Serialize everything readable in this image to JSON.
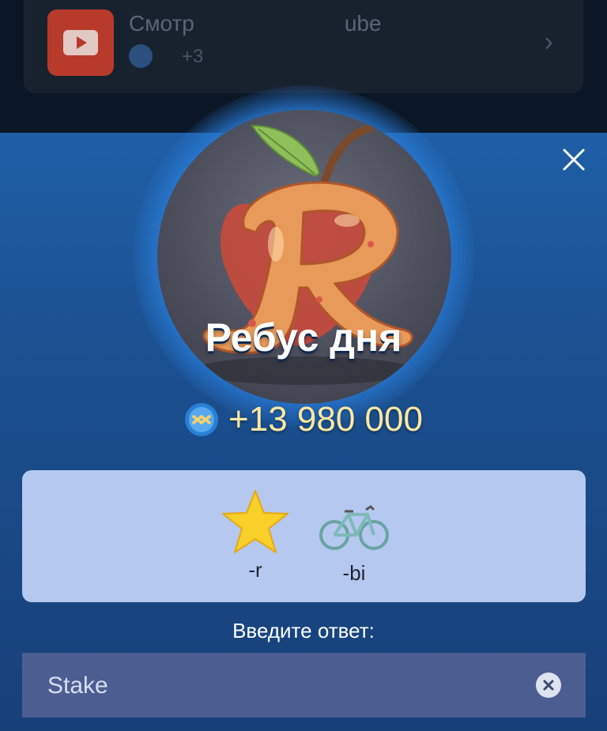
{
  "background_task": {
    "title": "Смотр",
    "title_tail": "ube",
    "reward_prefix": "+3"
  },
  "modal": {
    "title": "Ребус дня",
    "reward": "+13 980 000",
    "puzzle": {
      "items": [
        {
          "icon": "star-icon",
          "hint": "-r"
        },
        {
          "icon": "bicycle-icon",
          "hint": "-bi"
        }
      ]
    },
    "prompt": "Введите ответ:",
    "answer": {
      "value": "Stake"
    }
  },
  "colors": {
    "sheet_top": "#1f5fa6",
    "sheet_bottom": "#174079",
    "puzzle_card": "#b5c8f0",
    "answer_field": "#4c5e91",
    "reward_text": "#fde8a0"
  }
}
